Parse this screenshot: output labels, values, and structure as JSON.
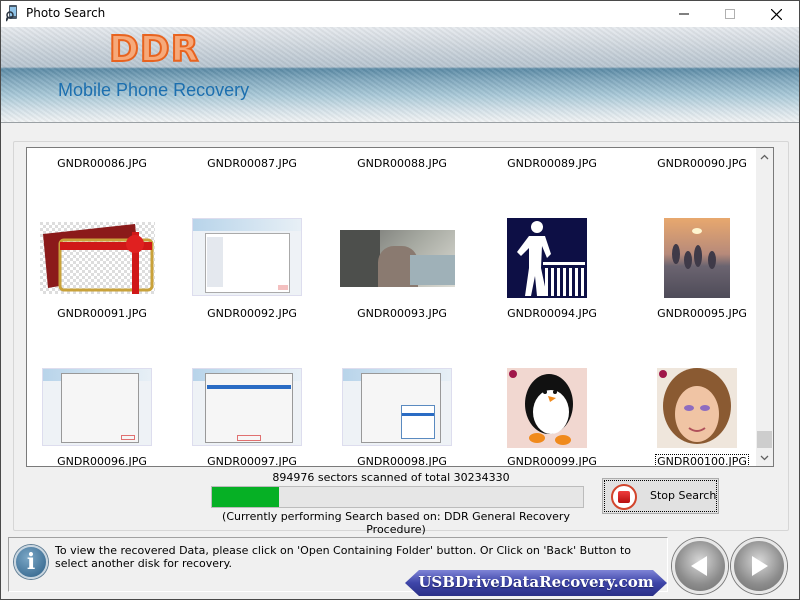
{
  "window": {
    "title": "Photo Search",
    "controls": {
      "minimize": "minimize",
      "maximize": "maximize",
      "close": "close"
    }
  },
  "banner": {
    "logo": "DDR",
    "product": "Mobile Phone Recovery"
  },
  "gallery": {
    "items": [
      {
        "name": "GNDR00086.JPG",
        "thumb": "none"
      },
      {
        "name": "GNDR00087.JPG",
        "thumb": "none"
      },
      {
        "name": "GNDR00088.JPG",
        "thumb": "none"
      },
      {
        "name": "GNDR00089.JPG",
        "thumb": "none"
      },
      {
        "name": "GNDR00090.JPG",
        "thumb": "none"
      },
      {
        "name": "GNDR00091.JPG",
        "thumb": "gift-card"
      },
      {
        "name": "GNDR00092.JPG",
        "thumb": "software-screenshot"
      },
      {
        "name": "GNDR00093.JPG",
        "thumb": "office-photo"
      },
      {
        "name": "GNDR00094.JPG",
        "thumb": "man-leaning-icon"
      },
      {
        "name": "GNDR00095.JPG",
        "thumb": "sunset-silhouettes"
      },
      {
        "name": "GNDR00096.JPG",
        "thumb": "software-screenshot"
      },
      {
        "name": "GNDR00097.JPG",
        "thumb": "software-screenshot"
      },
      {
        "name": "GNDR00098.JPG",
        "thumb": "software-screenshot"
      },
      {
        "name": "GNDR00099.JPG",
        "thumb": "penguin"
      },
      {
        "name": "GNDR00100.JPG",
        "thumb": "girl-portrait",
        "selected": true
      }
    ]
  },
  "progress": {
    "status": "894976 sectors scanned of total 30234330",
    "sectors_scanned": 894976,
    "sectors_total": 30234330,
    "bar_fill_fraction": 0.18,
    "procedure": "(Currently performing Search based on:  DDR General Recovery Procedure)",
    "bar_color": "#06b025"
  },
  "actions": {
    "stop_search": "Stop Search"
  },
  "info": {
    "message": "To view the recovered Data, please click on 'Open Containing Folder' button. Or Click on 'Back' Button to select another disk for recovery."
  },
  "footer": {
    "website": "USBDriveDataRecovery.com",
    "back": "back",
    "next": "next"
  }
}
